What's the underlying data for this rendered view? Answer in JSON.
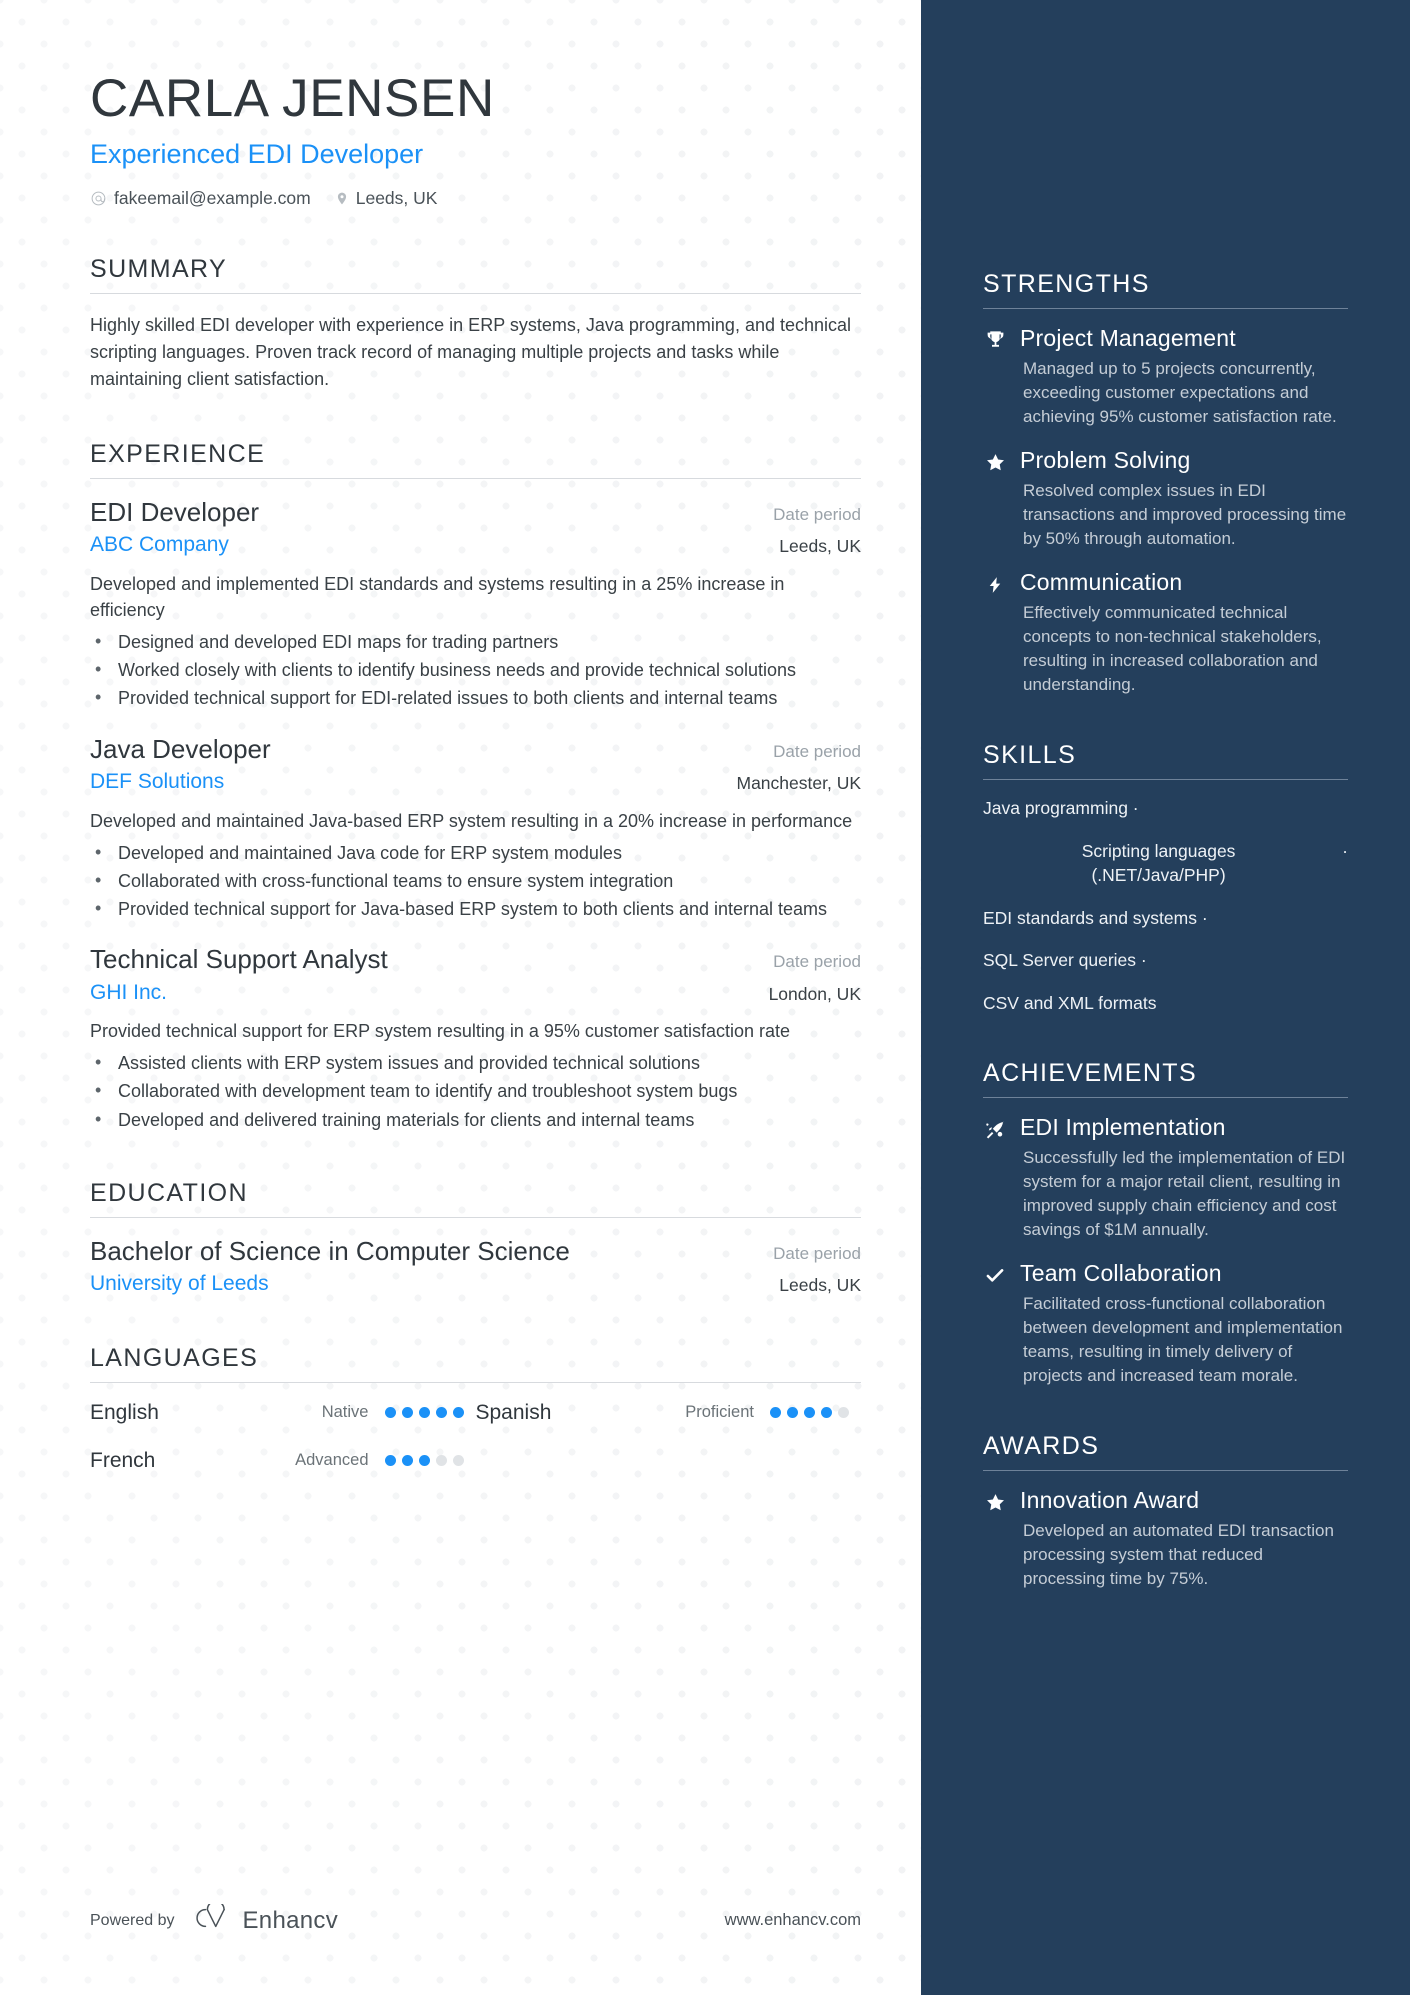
{
  "profile": {
    "name": "CARLA JENSEN",
    "headline": "Experienced EDI Developer",
    "email": "fakeemail@example.com",
    "location": "Leeds, UK"
  },
  "summary": {
    "title": "SUMMARY",
    "text": "Highly skilled EDI developer with experience in ERP systems, Java programming, and technical scripting languages. Proven track record of managing multiple projects and tasks while maintaining client satisfaction."
  },
  "experience": {
    "title": "EXPERIENCE",
    "entries": [
      {
        "role": "EDI Developer",
        "date": "Date period",
        "company": "ABC Company",
        "location": "Leeds, UK",
        "description": "Developed and implemented EDI standards and systems resulting in a 25% increase in efficiency",
        "bullets": [
          "Designed and developed EDI maps for trading partners",
          "Worked closely with clients to identify business needs and provide technical solutions",
          "Provided technical support for EDI-related issues to both clients and internal teams"
        ]
      },
      {
        "role": "Java Developer",
        "date": "Date period",
        "company": "DEF Solutions",
        "location": "Manchester, UK",
        "description": "Developed and maintained Java-based ERP system resulting in a 20% increase in performance",
        "bullets": [
          "Developed and maintained Java code for ERP system modules",
          "Collaborated with cross-functional teams to ensure system integration",
          "Provided technical support for Java-based ERP system to both clients and internal teams"
        ]
      },
      {
        "role": "Technical Support Analyst",
        "date": "Date period",
        "company": "GHI Inc.",
        "location": "London, UK",
        "description": "Provided technical support for ERP system resulting in a 95% customer satisfaction rate",
        "bullets": [
          "Assisted clients with ERP system issues and provided technical solutions",
          "Collaborated with development team to identify and troubleshoot system bugs",
          "Developed and delivered training materials for clients and internal teams"
        ]
      }
    ]
  },
  "education": {
    "title": "EDUCATION",
    "entries": [
      {
        "degree": "Bachelor of Science in Computer Science",
        "date": "Date period",
        "school": "University of Leeds",
        "location": "Leeds, UK"
      }
    ]
  },
  "languages": {
    "title": "LANGUAGES",
    "items": [
      {
        "name": "English",
        "level": "Native",
        "rating": 5,
        "max": 5
      },
      {
        "name": "Spanish",
        "level": "Proficient",
        "rating": 4,
        "max": 5
      },
      {
        "name": "French",
        "level": "Advanced",
        "rating": 3,
        "max": 5
      }
    ]
  },
  "footer": {
    "powered_by": "Powered by",
    "brand": "Enhancv",
    "website": "www.enhancv.com"
  },
  "strengths": {
    "title": "STRENGTHS",
    "items": [
      {
        "icon": "trophy-icon",
        "title": "Project Management",
        "desc": "Managed up to 5 projects concurrently, exceeding customer expectations and achieving 95% customer satisfaction rate."
      },
      {
        "icon": "star-icon",
        "title": "Problem Solving",
        "desc": "Resolved complex issues in EDI transactions and improved processing time by 50% through automation."
      },
      {
        "icon": "lightning-bolt-icon",
        "title": "Communication",
        "desc": "Effectively communicated technical concepts to non-technical stakeholders, resulting in increased collaboration and understanding."
      }
    ]
  },
  "skills": {
    "title": "SKILLS",
    "separator": "·",
    "items": [
      "Java programming",
      "Scripting languages (.NET/Java/PHP)",
      "EDI standards and systems",
      "SQL Server queries",
      "CSV and XML formats"
    ]
  },
  "achievements": {
    "title": "ACHIEVEMENTS",
    "items": [
      {
        "icon": "rocket-icon",
        "title": "EDI Implementation",
        "desc": "Successfully led the implementation of EDI system for a major retail client, resulting in improved supply chain efficiency and cost savings of $1M annually."
      },
      {
        "icon": "check-icon",
        "title": "Team Collaboration",
        "desc": "Facilitated cross-functional collaboration between development and implementation teams, resulting in timely delivery of projects and increased team morale."
      }
    ]
  },
  "awards": {
    "title": "AWARDS",
    "items": [
      {
        "icon": "star-icon",
        "title": "Innovation Award",
        "desc": "Developed an automated EDI transaction processing system that reduced processing time by 75%."
      }
    ]
  },
  "colors": {
    "accent": "#1b91f7",
    "sidebar_bg": "#243f5c",
    "heading": "#30373d",
    "body_text": "#3a4146",
    "muted": "#9aa2a9"
  }
}
